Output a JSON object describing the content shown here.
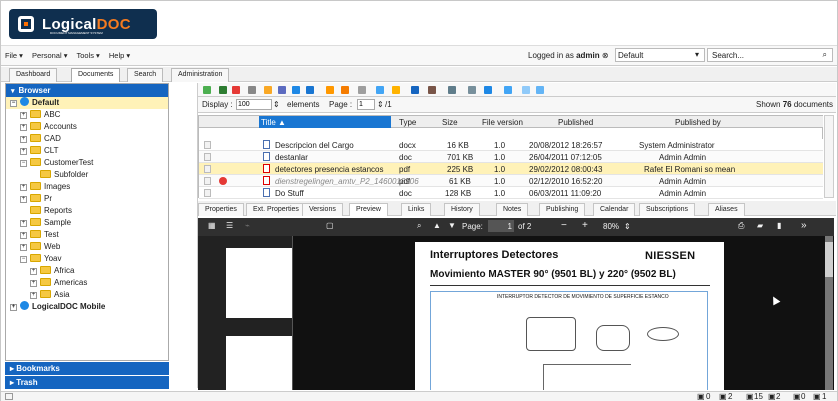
{
  "app": {
    "logo_prefix": "Logical",
    "logo_suffix": "DOC",
    "logo_subtitle": "DOCUMENT MANAGEMENT SYSTEM"
  },
  "menu": [
    "File ▾",
    "Personal ▾",
    "Tools ▾",
    "Help ▾"
  ],
  "header": {
    "logged_in_label": "Logged in as",
    "user": "admin",
    "default_value": "Default",
    "search_placeholder": "Search..."
  },
  "tabs": [
    "Dashboard",
    "Documents",
    "Search",
    "Administration"
  ],
  "browser": {
    "title": "Browser",
    "tree": [
      {
        "label": "Default",
        "level": 0,
        "type": "globe",
        "expanded": true
      },
      {
        "label": "ABC",
        "level": 1,
        "type": "folder"
      },
      {
        "label": "Accounts",
        "level": 1,
        "type": "folder"
      },
      {
        "label": "CAD",
        "level": 1,
        "type": "folder"
      },
      {
        "label": "CLT",
        "level": 1,
        "type": "folder"
      },
      {
        "label": "CustomerTest",
        "level": 1,
        "type": "folder",
        "expanded": true
      },
      {
        "label": "Subfolder",
        "level": 2,
        "type": "folder"
      },
      {
        "label": "Images",
        "level": 1,
        "type": "folder"
      },
      {
        "label": "Pr",
        "level": 1,
        "type": "folder"
      },
      {
        "label": "Reports",
        "level": 1,
        "type": "folder"
      },
      {
        "label": "Sample",
        "level": 1,
        "type": "folder"
      },
      {
        "label": "Test",
        "level": 1,
        "type": "folder"
      },
      {
        "label": "Web",
        "level": 1,
        "type": "folder"
      },
      {
        "label": "Yoav",
        "level": 1,
        "type": "folder",
        "expanded": true
      },
      {
        "label": "Africa",
        "level": 2,
        "type": "folder"
      },
      {
        "label": "Americas",
        "level": 2,
        "type": "folder"
      },
      {
        "label": "Asia",
        "level": 2,
        "type": "folder"
      },
      {
        "label": "LogicalDOC Mobile",
        "level": 0,
        "type": "globe"
      }
    ],
    "bookmarks": "Bookmarks",
    "trash": "Trash"
  },
  "filter": {
    "display_label": "Display :",
    "display_value": "100",
    "elements_label": "elements",
    "page_label": "Page :",
    "page_value": "1",
    "page_total": "/1",
    "shown_label": "Shown",
    "shown_count": "76",
    "documents_label": "documents"
  },
  "grid": {
    "headers": {
      "title": "Title",
      "type": "Type",
      "size": "Size",
      "version": "File version",
      "published": "Published",
      "published_by": "Published by"
    },
    "rows": [
      {
        "title": "Descripcion del Cargo",
        "type": "docx",
        "size": "16 KB",
        "version": "1.0",
        "published": "20/08/2012 18:26:57",
        "by": "System Administrator"
      },
      {
        "title": "destanlar",
        "type": "doc",
        "size": "701 KB",
        "version": "1.0",
        "published": "26/04/2011 07:12:05",
        "by": "Admin Admin"
      },
      {
        "title": "detectores presencia estancos",
        "type": "pdf",
        "size": "225 KB",
        "version": "1.0",
        "published": "29/02/2012 08:00:43",
        "by": "Rafet El Romani so mean"
      },
      {
        "title": "dienstregelingen_amtv_P2_1460018906",
        "type": "pdf",
        "size": "61 KB",
        "version": "1.0",
        "published": "02/12/2010 16:52:20",
        "by": "Admin Admin"
      },
      {
        "title": "Do Stuff",
        "type": "doc",
        "size": "128 KB",
        "version": "1.0",
        "published": "06/03/2011 11:09:20",
        "by": "Admin Admin"
      }
    ]
  },
  "preview_tabs": [
    "Properties",
    "Ext. Properties",
    "Versions",
    "Preview",
    "Links",
    "History",
    "Notes",
    "Publishing",
    "Calendar",
    "Subscriptions",
    "Aliases"
  ],
  "viewer": {
    "page_label": "Page:",
    "page_value": "1",
    "page_of": "of 2",
    "zoom": "80%"
  },
  "pdf": {
    "title": "Interruptores Detectores",
    "brand": "NIESSEN",
    "subtitle": "Movimiento MASTER 90° (9501 BL) y 220° (9502 BL)",
    "diagram_title": "INTERRUPTOR DETECTOR DE MOVIMIENTO DE SUPERFICIE ESTANCO"
  },
  "status": {
    "counts": [
      "0",
      "2",
      "15",
      "2",
      "0",
      "1"
    ]
  },
  "colors": {
    "accent": "#1565c0",
    "selected": "#fff2b8",
    "logo": "#0f2f4f",
    "orange": "#f47b20"
  }
}
